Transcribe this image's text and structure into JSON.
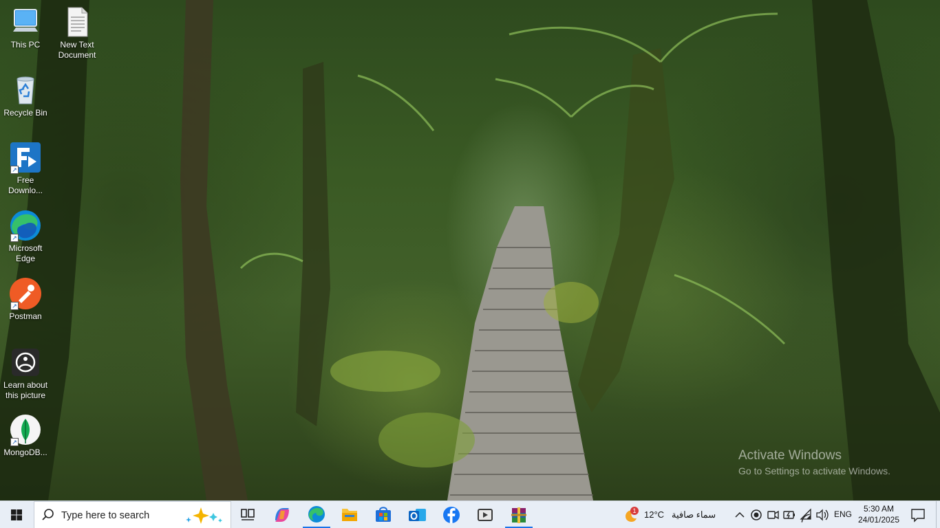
{
  "desktop": {
    "icons": [
      {
        "label": "This PC"
      },
      {
        "label": "New Text Document"
      },
      {
        "label": "Recycle Bin"
      },
      {
        "label": "Free Downlo..."
      },
      {
        "label": "Microsoft Edge"
      },
      {
        "label": "Postman"
      },
      {
        "label": "Learn about this picture"
      },
      {
        "label": "MongoDB..."
      }
    ]
  },
  "watermark": {
    "title": "Activate Windows",
    "subtitle": "Go to Settings to activate Windows."
  },
  "taskbar": {
    "search_placeholder": "Type here to search",
    "apps": [
      "task-view",
      "copilot",
      "microsoft-edge",
      "file-explorer",
      "microsoft-store",
      "outlook",
      "facebook",
      "media-player",
      "winrar"
    ],
    "weather": {
      "badge": "1",
      "temperature": "12°C",
      "condition": "سماء صافية"
    },
    "language": "ENG",
    "time": "5:30 AM",
    "date": "24/01/2025"
  },
  "colors": {
    "taskbar_bg": "#e8eef6",
    "accent": "#1a73e8"
  }
}
